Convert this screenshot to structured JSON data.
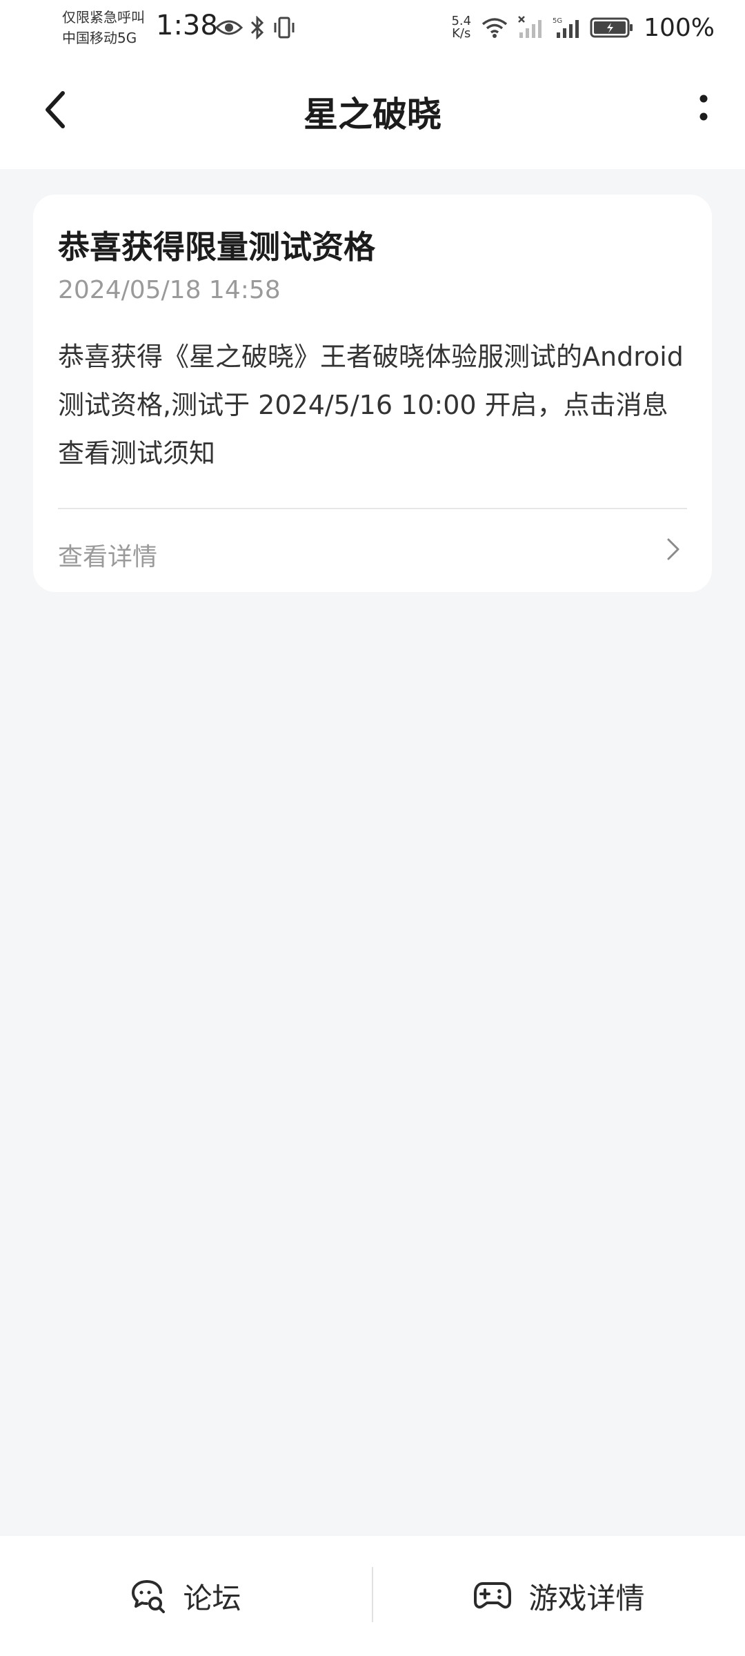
{
  "status_bar": {
    "carrier_line1": "仅限紧急呼叫",
    "carrier_line2": "中国移动5G",
    "time": "1:38",
    "net_speed_value": "5.4",
    "net_speed_unit": "K/s",
    "battery": "100%",
    "icons": [
      "eye-icon",
      "bluetooth-icon",
      "vibrate-icon",
      "wifi-icon",
      "signal-icon",
      "signal-5g-icon",
      "battery-icon"
    ]
  },
  "header": {
    "title": "星之破晓",
    "back_icon": "chevron-left-icon",
    "more_icon": "more-vertical-icon"
  },
  "message": {
    "title": "恭喜获得限量测试资格",
    "time": "2024/05/18 14:58",
    "body": "恭喜获得《星之破晓》王者破晓体验服测试的Android测试资格,测试于 2024/5/16 10:00 开启，点击消息查看测试须知",
    "link_label": "查看详情"
  },
  "bottom_bar": {
    "forum_label": "论坛",
    "forum_icon": "forum-chat-icon",
    "game_detail_label": "游戏详情",
    "game_detail_icon": "gamepad-icon"
  },
  "colors": {
    "background": "#f5f6f8",
    "card": "#ffffff",
    "secondary_text": "#9a9a9a"
  }
}
